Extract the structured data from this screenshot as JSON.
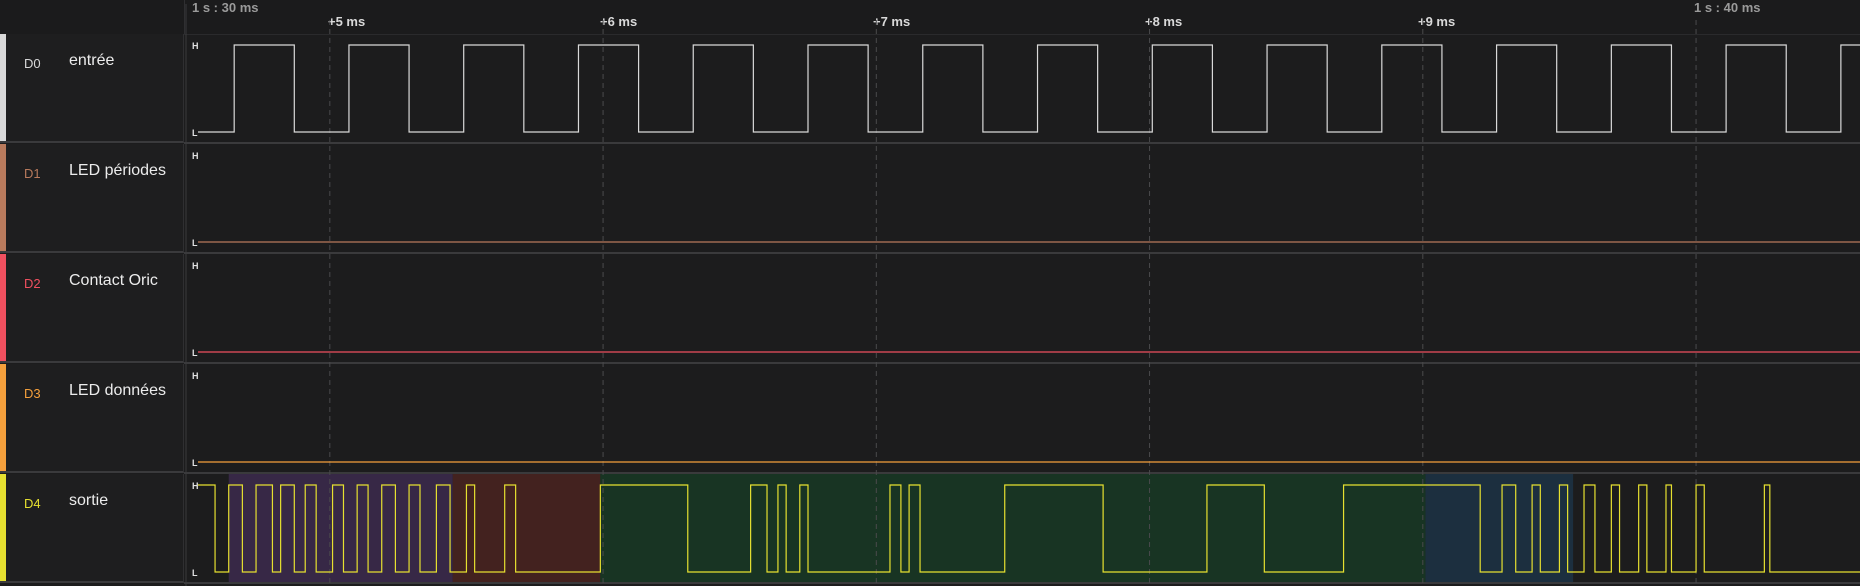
{
  "ruler": {
    "start_label": "1 s : 30 ms",
    "end_label": "1 s : 40 ms",
    "ticks": [
      "+5 ms",
      "+6 ms",
      "+7 ms",
      "+8 ms",
      "+9 ms"
    ]
  },
  "channels": [
    {
      "id": "D0",
      "name": "entrée",
      "color": "#d9d9d9",
      "high_label": "H",
      "low_label": "L"
    },
    {
      "id": "D1",
      "name": "LED périodes",
      "color": "#b97a5c",
      "high_label": "H",
      "low_label": "L"
    },
    {
      "id": "D2",
      "name": "Contact Oric",
      "color": "#f0505f",
      "high_label": "H",
      "low_label": "L"
    },
    {
      "id": "D3",
      "name": "LED données",
      "color": "#f5a03c",
      "high_label": "H",
      "low_label": "L"
    },
    {
      "id": "D4",
      "name": "sortie",
      "color": "#e6e030",
      "high_label": "H",
      "low_label": "L"
    }
  ],
  "timeline_ms": {
    "start": 4.47,
    "end": 10.6
  },
  "signals": {
    "D0": {
      "initial": 0,
      "toggles_ms": [
        4.65,
        4.87,
        5.07,
        5.29,
        5.49,
        5.71,
        5.91,
        6.13,
        6.33,
        6.55,
        6.75,
        6.97,
        7.17,
        7.39,
        7.59,
        7.81,
        8.01,
        8.23,
        8.43,
        8.65,
        8.85,
        9.07,
        9.27,
        9.49,
        9.69,
        9.91,
        10.11,
        10.33,
        10.53
      ]
    },
    "D1": {
      "initial": 0,
      "toggles_ms": []
    },
    "D2": {
      "initial": 0,
      "toggles_ms": []
    },
    "D3": {
      "initial": 0,
      "toggles_ms": []
    },
    "D4": {
      "initial": 1,
      "toggles_ms": [
        4.58,
        4.63,
        4.68,
        4.73,
        4.79,
        4.82,
        4.87,
        4.91,
        4.95,
        5.01,
        5.05,
        5.1,
        5.14,
        5.19,
        5.24,
        5.29,
        5.33,
        5.39,
        5.44,
        5.5,
        5.53,
        5.64,
        5.68,
        5.99,
        6.31,
        6.54,
        6.6,
        6.64,
        6.67,
        6.72,
        6.75,
        7.05,
        7.09,
        7.12,
        7.16,
        7.47,
        7.83,
        8.21,
        8.42,
        8.71,
        9.21,
        9.29,
        9.34,
        9.4,
        9.43,
        9.5,
        9.53,
        9.59,
        9.63,
        9.69,
        9.72,
        9.79,
        9.82,
        9.89,
        9.91,
        10.0,
        10.03,
        10.25,
        10.27
      ]
    }
  },
  "annotations_D4": [
    {
      "start_ms": 4.63,
      "end_ms": 5.45,
      "color": "#3c2a4d"
    },
    {
      "start_ms": 5.45,
      "end_ms": 5.99,
      "color": "#4a2320"
    },
    {
      "start_ms": 5.99,
      "end_ms": 9.01,
      "color": "#173824"
    },
    {
      "start_ms": 9.01,
      "end_ms": 9.55,
      "color": "#1c3345"
    }
  ]
}
